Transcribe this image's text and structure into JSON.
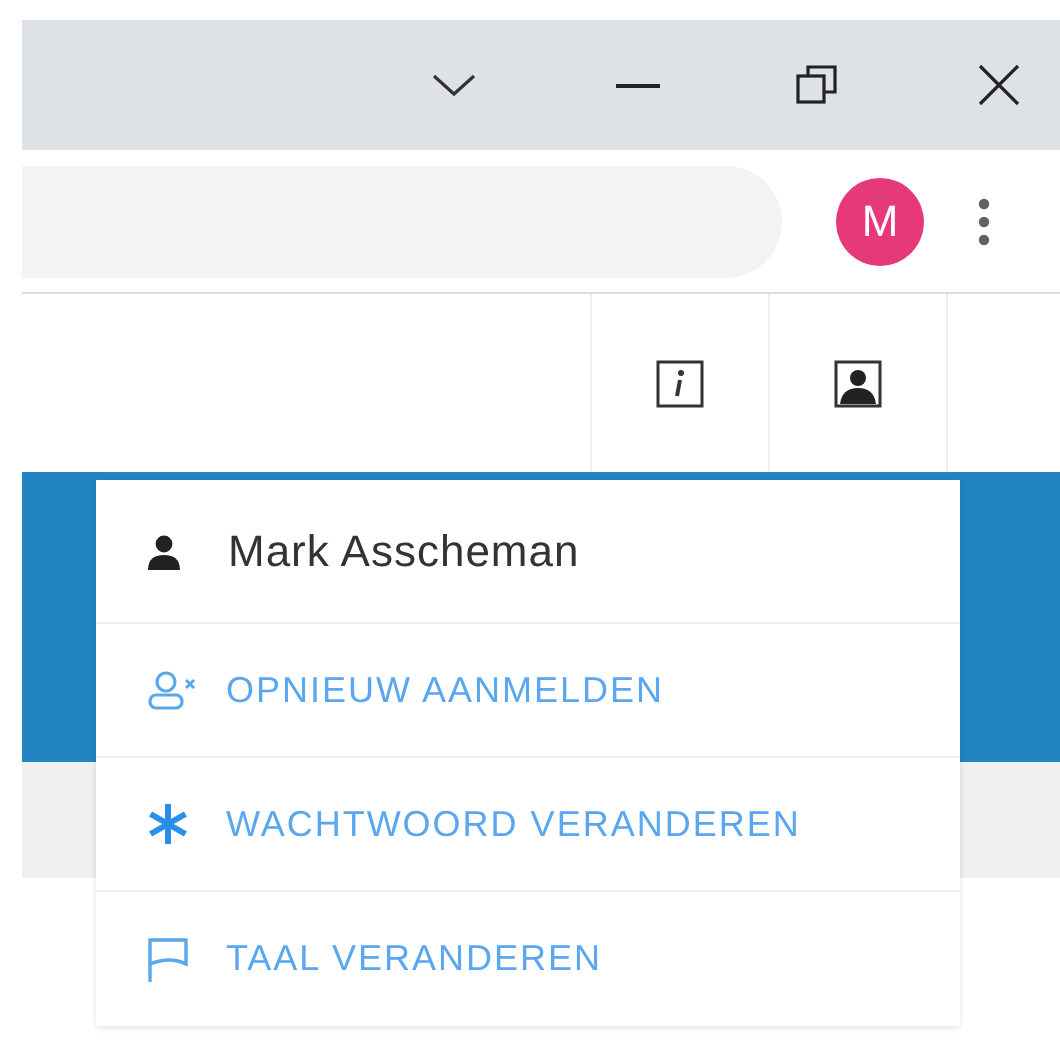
{
  "browser": {
    "avatar_letter": "M"
  },
  "user_menu": {
    "user_name": "Mark Asscheman",
    "items": [
      {
        "kind": "relogin",
        "label": "OPNIEUW AANMELDEN"
      },
      {
        "kind": "password",
        "label": "WACHTWOORD VERANDEREN"
      },
      {
        "kind": "language",
        "label": "TAAL VERANDEREN"
      }
    ]
  }
}
